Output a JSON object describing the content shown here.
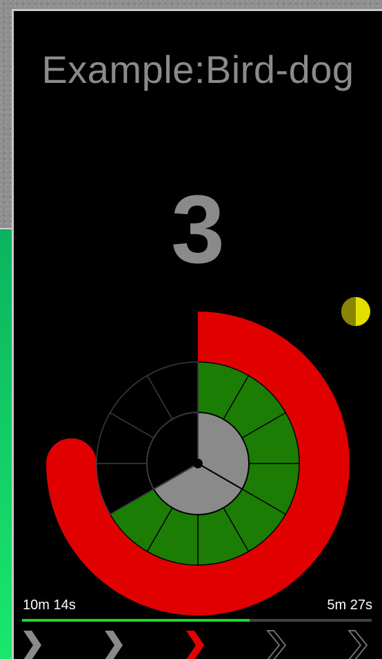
{
  "screen": {
    "title": "Example:Bird-dog",
    "rep_count": "3",
    "elapsed_label": "10m 14s",
    "remaining_label": "5m 27s",
    "progress_fraction": 0.65
  },
  "ring": {
    "outer_progress_fraction": 0.75,
    "middle_segments_total": 12,
    "middle_segments_filled": 8,
    "inner_segments_total": 3,
    "inner_segments_filled": 2
  },
  "steps": [
    {
      "state": "done"
    },
    {
      "state": "done"
    },
    {
      "state": "current"
    },
    {
      "state": "upcoming"
    },
    {
      "state": "upcoming"
    }
  ],
  "colors": {
    "outer_ring": "#e00000",
    "middle_filled": "#1c7d05",
    "inner_filled": "#8a8a8a",
    "progress": "#1fd629",
    "side_indicator_light": "#e3e000",
    "side_indicator_dark": "#8a8400",
    "step_done": "#8a8a8a",
    "step_current": "#e00000",
    "step_upcoming": "#6f6f6f"
  },
  "icons": {
    "side_indicator": "half-circle-icon",
    "step": "chevron-right-icon"
  }
}
